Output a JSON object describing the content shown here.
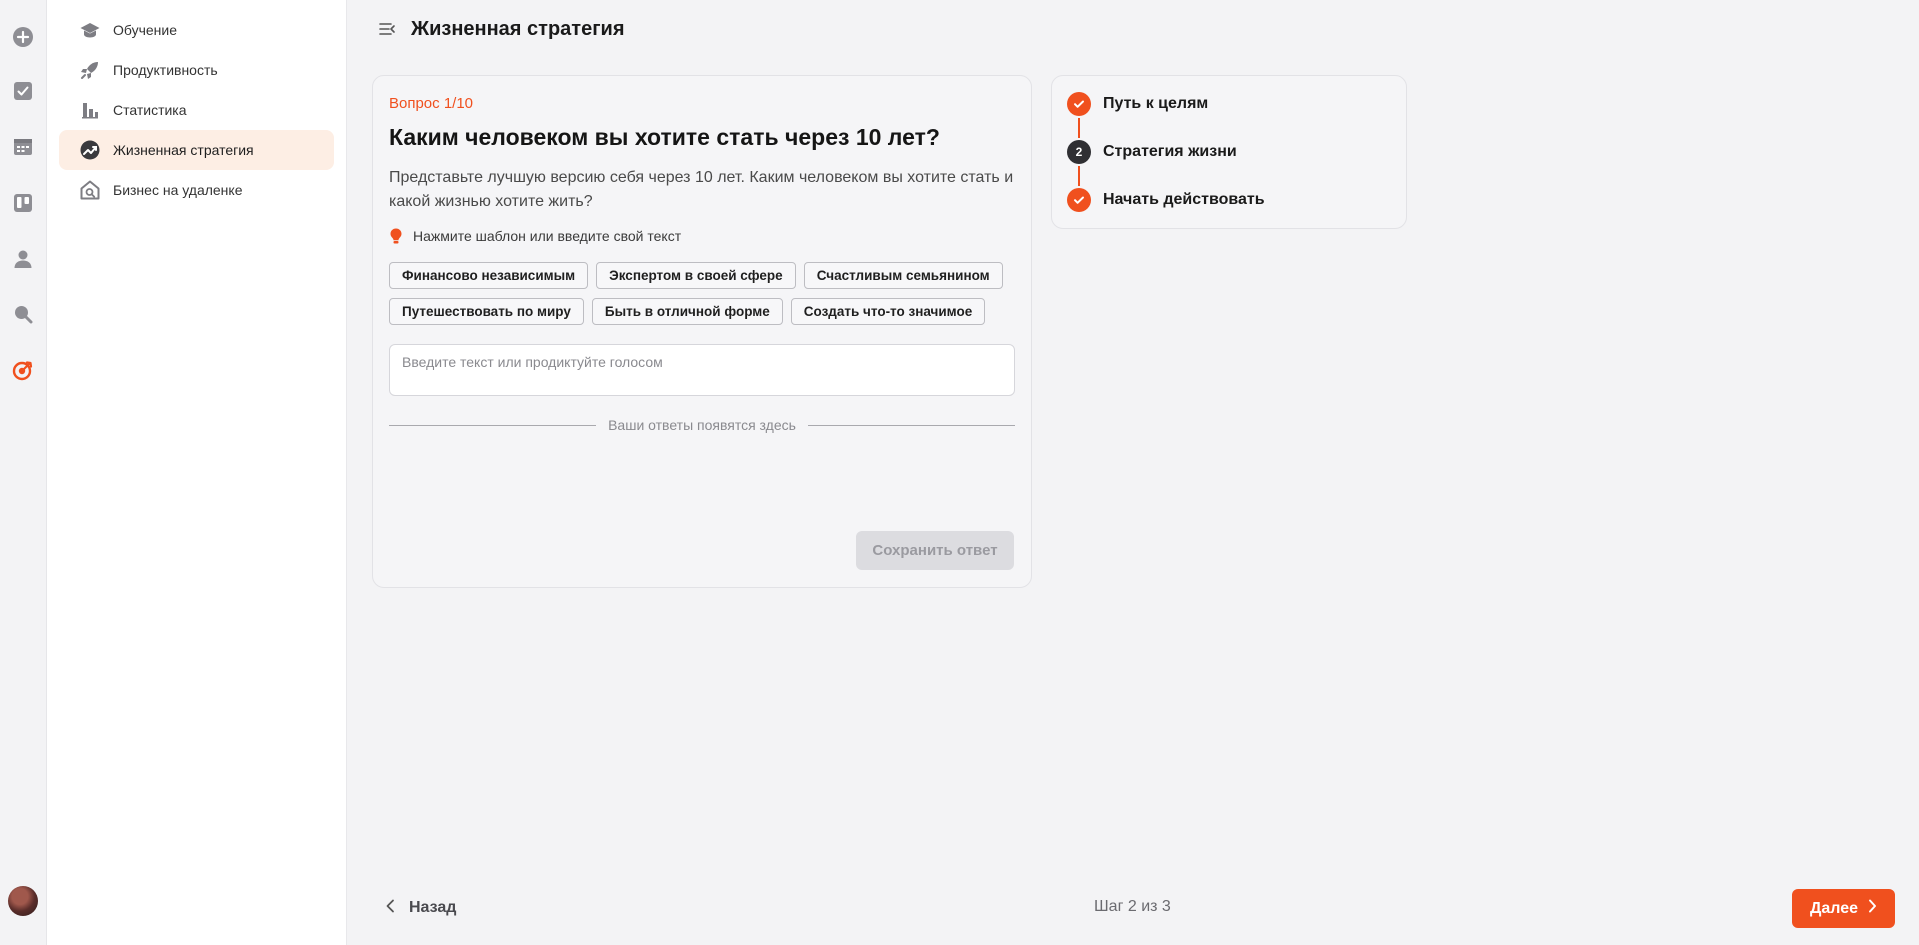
{
  "rail": {
    "icons": [
      "plus-circle-icon",
      "checkbox-icon",
      "calendar-icon",
      "board-icon",
      "user-icon",
      "search-icon",
      "target-icon",
      "avatar"
    ]
  },
  "sidebar": {
    "items": [
      {
        "label": "Обучение",
        "icon": "graduation-cap-icon"
      },
      {
        "label": "Продуктивность",
        "icon": "rocket-icon"
      },
      {
        "label": "Статистика",
        "icon": "bar-chart-icon"
      },
      {
        "label": "Жизненная стратегия",
        "icon": "trend-icon",
        "active": true
      },
      {
        "label": "Бизнес на удаленке",
        "icon": "home-search-icon"
      }
    ]
  },
  "header": {
    "title": "Жизненная стратегия"
  },
  "question": {
    "counter": "Вопрос 1/10",
    "title": "Каким человеком вы хотите стать через 10 лет?",
    "description": "Представьте лучшую версию себя через 10 лет. Каким человеком вы хотите стать и какой жизнью хотите жить?",
    "hint": "Нажмите шаблон или введите свой текст",
    "chips": [
      "Финансово независимым",
      "Экспертом в своей сфере",
      "Счастливым семьянином",
      "Путешествовать по миру",
      "Быть в отличной форме",
      "Создать что-то значимое"
    ],
    "input_placeholder": "Введите текст или продиктуйте голосом",
    "input_value": "",
    "answers_placeholder": "Ваши ответы появятся здесь",
    "save_label": "Сохранить ответ"
  },
  "steps": [
    {
      "label": "Путь к целям",
      "status": "done",
      "number": ""
    },
    {
      "label": "Стратегия жизни",
      "status": "current",
      "number": "2"
    },
    {
      "label": "Начать действовать",
      "status": "done",
      "number": ""
    }
  ],
  "footer": {
    "back_label": "Назад",
    "step_counter": "Шаг 2 из 3",
    "next_label": "Далее"
  },
  "colors": {
    "accent": "#f0501e",
    "active_bg": "#fdeee4",
    "current_step": "#2f2f33"
  }
}
